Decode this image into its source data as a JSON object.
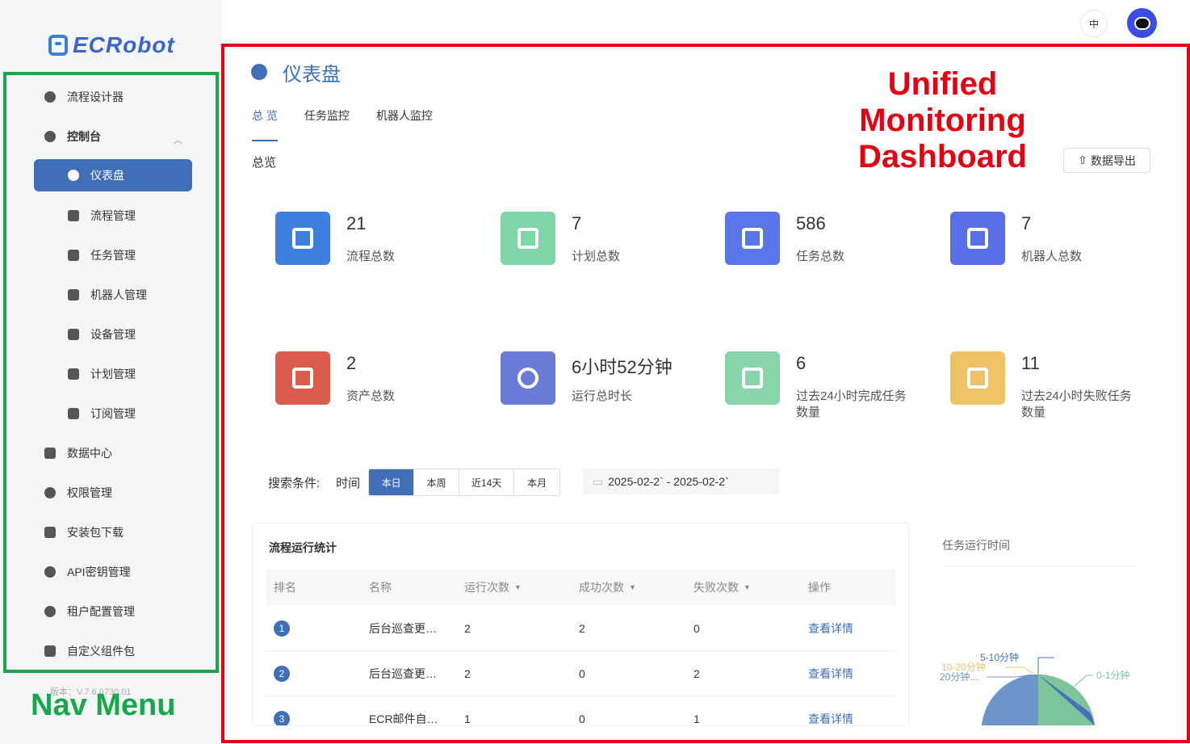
{
  "app": {
    "logo_text": "ECRobot",
    "version": "版本：V.7.6.0730.01"
  },
  "nav": {
    "annotation": "Nav Menu",
    "items": [
      {
        "label": "流程设计器",
        "icon": "compass-icon"
      },
      {
        "label": "控制台",
        "icon": "pie-chart-icon"
      },
      {
        "label": "仪表盘",
        "icon": "dashboard-icon"
      },
      {
        "label": "流程管理",
        "icon": "flow-icon"
      },
      {
        "label": "任务管理",
        "icon": "clipboard-icon"
      },
      {
        "label": "机器人管理",
        "icon": "robot-icon"
      },
      {
        "label": "设备管理",
        "icon": "server-icon"
      },
      {
        "label": "计划管理",
        "icon": "calendar-icon"
      },
      {
        "label": "订阅管理",
        "icon": "subscribe-icon"
      },
      {
        "label": "数据中心",
        "icon": "bar-chart-icon"
      },
      {
        "label": "权限管理",
        "icon": "shield-icon"
      },
      {
        "label": "安装包下载",
        "icon": "download-icon"
      },
      {
        "label": "API密钥管理",
        "icon": "key-icon"
      },
      {
        "label": "租户配置管理",
        "icon": "gear-icon"
      },
      {
        "label": "自定义组件包",
        "icon": "package-icon"
      }
    ]
  },
  "topbar": {
    "lang": "中"
  },
  "page": {
    "title": "仪表盘",
    "annotation": "Unified Monitoring Dashboard",
    "tabs": [
      "总 览",
      "任务监控",
      "机器人监控"
    ],
    "sub_label": "总览",
    "export_label": "数据导出"
  },
  "stats": [
    {
      "value": "21",
      "label": "流程总数",
      "color": "#3f80df"
    },
    {
      "value": "7",
      "label": "计划总数",
      "color": "#7ed6a6"
    },
    {
      "value": "586",
      "label": "任务总数",
      "color": "#5a76e8"
    },
    {
      "value": "7",
      "label": "机器人总数",
      "color": "#5a6ee8"
    },
    {
      "value": "2",
      "label": "资产总数",
      "color": "#dc5c4c"
    },
    {
      "value": "6小时52分钟",
      "label": "运行总时长",
      "color": "#6d7bd8"
    },
    {
      "value": "6",
      "label": "过去24小时完成任务数量",
      "color": "#88d4ab"
    },
    {
      "value": "11",
      "label": "过去24小时失败任务数量",
      "color": "#f0c266"
    }
  ],
  "search": {
    "label": "搜索条件:",
    "time_label": "时间",
    "options": [
      "本日",
      "本周",
      "近14天",
      "本月"
    ],
    "selected": "本日",
    "date_range": "2025-02-2` - 2025-02-2`"
  },
  "table": {
    "title": "流程运行统计",
    "headers": [
      "排名",
      "名称",
      "运行次数",
      "成功次数",
      "失败次数",
      "操作"
    ],
    "rows": [
      {
        "rank": "1",
        "name": "后台巡查更…",
        "runs": "2",
        "success": "2",
        "fail": "0",
        "action": "查看详情"
      },
      {
        "rank": "2",
        "name": "后台巡查更…",
        "runs": "2",
        "success": "0",
        "fail": "2",
        "action": "查看详情"
      },
      {
        "rank": "3",
        "name": "ECR邮件自…",
        "runs": "1",
        "success": "0",
        "fail": "1",
        "action": "查看详情"
      }
    ]
  },
  "pie": {
    "title": "任务运行时间",
    "labels": [
      "5-10分钟",
      "10-20分钟",
      "20分钟...",
      "0-1分钟"
    ]
  },
  "chart_data": {
    "type": "pie",
    "title": "任务运行时间",
    "categories": [
      "0-1分钟",
      "5-10分钟",
      "10-20分钟",
      "20分钟..."
    ],
    "colors": [
      "#7cc49a",
      "#4a6fb8",
      "#f0c266",
      "#6d95c9"
    ]
  }
}
